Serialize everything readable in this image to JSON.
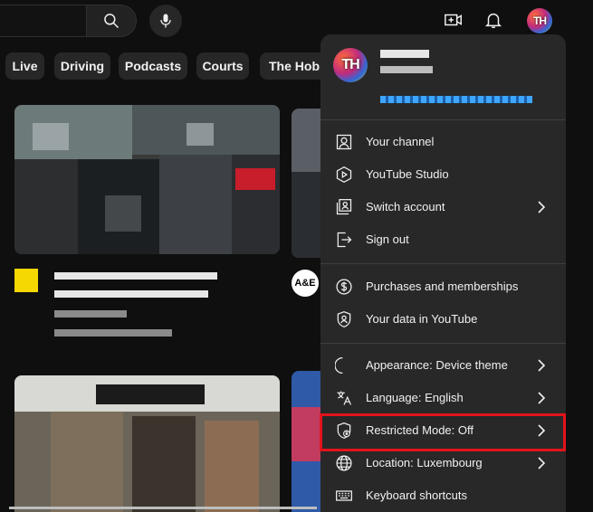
{
  "topbar": {
    "search_icon": "search-icon",
    "mic_icon": "mic-icon",
    "create_icon": "create-video-icon",
    "notifications_icon": "bell-icon",
    "avatar_initials": "TH"
  },
  "chips": [
    {
      "label": "Live"
    },
    {
      "label": "Driving"
    },
    {
      "label": "Podcasts"
    },
    {
      "label": "Courts"
    },
    {
      "label": "The Hobbi"
    }
  ],
  "video_2": {
    "channel_badge": "A&E"
  },
  "menu": {
    "avatar_initials": "TH",
    "sections": [
      [
        {
          "icon": "person-icon",
          "label": "Your channel",
          "chevron": false
        },
        {
          "icon": "studio-icon",
          "label": "YouTube Studio",
          "chevron": false
        },
        {
          "icon": "switch-account-icon",
          "label": "Switch account",
          "chevron": true
        },
        {
          "icon": "sign-out-icon",
          "label": "Sign out",
          "chevron": false
        }
      ],
      [
        {
          "icon": "dollar-icon",
          "label": "Purchases and memberships",
          "chevron": false
        },
        {
          "icon": "shield-person-icon",
          "label": "Your data in YouTube",
          "chevron": false
        }
      ],
      [
        {
          "icon": "moon-icon",
          "label": "Appearance: Device theme",
          "chevron": true
        },
        {
          "icon": "translate-icon",
          "label": "Language: English",
          "chevron": true
        },
        {
          "icon": "restricted-shield-icon",
          "label": "Restricted Mode: Off",
          "chevron": true
        },
        {
          "icon": "globe-icon",
          "label": "Location: Luxembourg",
          "chevron": true
        },
        {
          "icon": "keyboard-icon",
          "label": "Keyboard shortcuts",
          "chevron": false
        }
      ]
    ]
  },
  "colors": {
    "background": "#0f0f0f",
    "menu_bg": "#282828",
    "highlight": "#e4131b",
    "link": "#3ea6ff"
  }
}
